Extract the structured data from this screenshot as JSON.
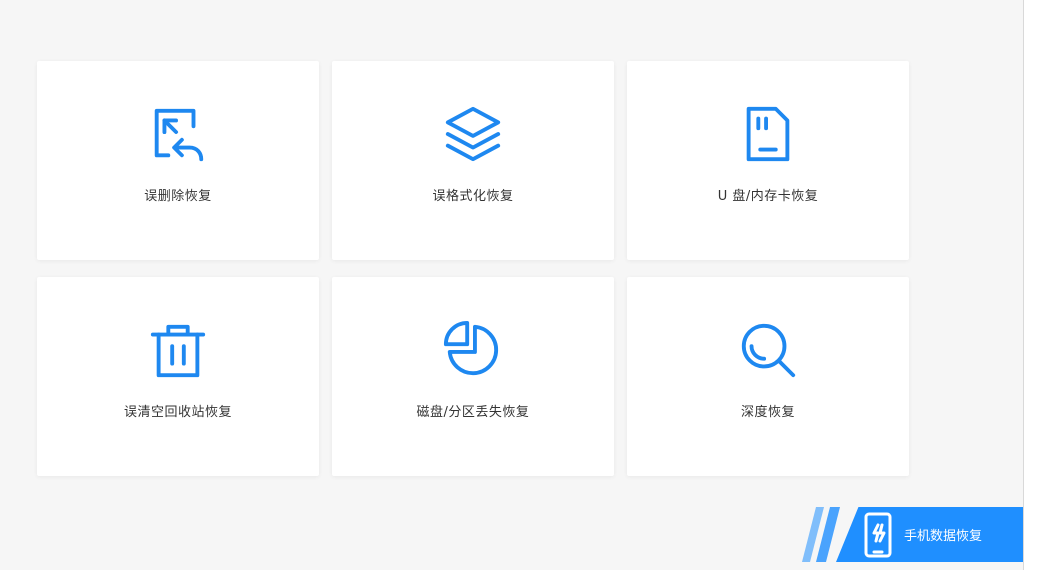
{
  "theme": {
    "accent": "#1e88f0",
    "background": "#f6f6f6",
    "card": "#ffffff",
    "text": "#333333"
  },
  "cards": [
    {
      "label": "误删除恢复",
      "icon": "file-restore-icon"
    },
    {
      "label": "误格式化恢复",
      "icon": "layers-icon"
    },
    {
      "label": "U 盘/内存卡恢复",
      "icon": "sd-card-icon"
    },
    {
      "label": "误清空回收站恢复",
      "icon": "trash-icon"
    },
    {
      "label": "磁盘/分区丢失恢复",
      "icon": "pie-chart-icon"
    },
    {
      "label": "深度恢复",
      "icon": "magnifier-icon"
    }
  ],
  "phone_banner": {
    "label": "手机数据恢复",
    "icon": "phone-icon",
    "color": "#1f8fff"
  }
}
